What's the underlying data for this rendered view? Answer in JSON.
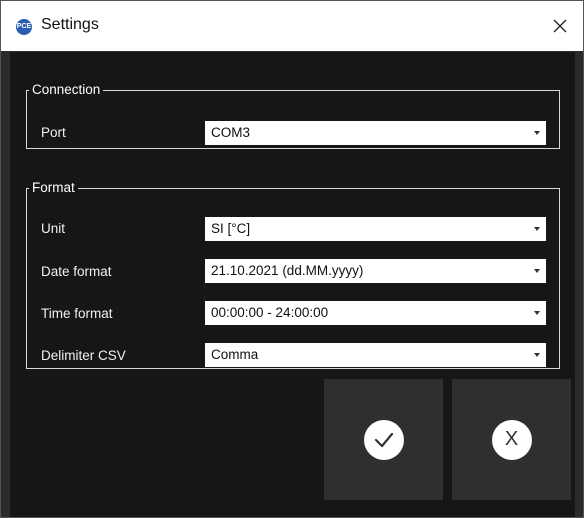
{
  "window": {
    "title": "Settings",
    "app_icon": "PCE"
  },
  "connection": {
    "legend": "Connection",
    "port_label": "Port",
    "port_value": "COM3"
  },
  "format": {
    "legend": "Format",
    "unit_label": "Unit",
    "unit_value": "SI [°C]",
    "date_label": "Date format",
    "date_value": "21.10.2021 (dd.MM.yyyy)",
    "time_label": "Time format",
    "time_value": "00:00:00 - 24:00:00",
    "delimiter_label": "Delimiter CSV",
    "delimiter_value": "Comma"
  },
  "actions": {
    "cancel_symbol": "X",
    "confirm_icon": "check-icon"
  },
  "colors": {
    "content_bg": "#161616",
    "tile_bg": "#2f2f2f",
    "titlebar_bg": "#ffffff"
  }
}
